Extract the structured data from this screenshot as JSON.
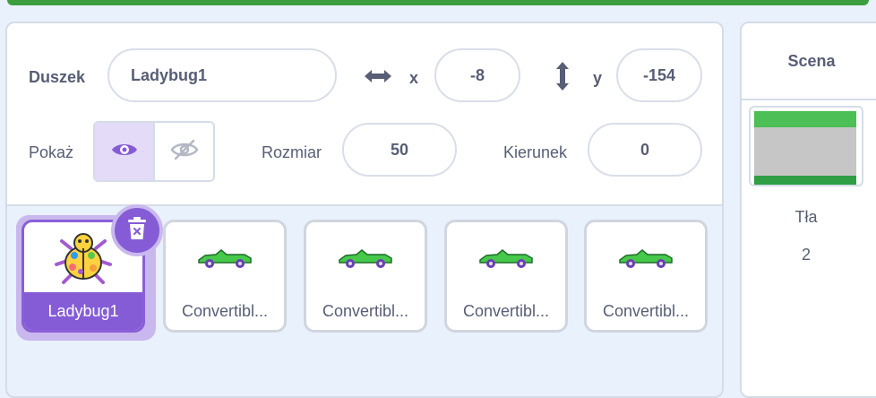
{
  "sprite_info": {
    "sprite_label": "Duszek",
    "sprite_name": "Ladybug1",
    "x_label": "x",
    "x_value": "-8",
    "y_label": "y",
    "y_value": "-154",
    "show_label": "Pokaż",
    "visible": true,
    "size_label": "Rozmiar",
    "size_value": "50",
    "direction_label": "Kierunek",
    "direction_value": "0"
  },
  "sprites": [
    {
      "name": "Ladybug1",
      "selected": true,
      "icon": "ladybug-icon"
    },
    {
      "name": "Convertibl...",
      "selected": false,
      "icon": "car-icon"
    },
    {
      "name": "Convertibl...",
      "selected": false,
      "icon": "car-icon"
    },
    {
      "name": "Convertibl...",
      "selected": false,
      "icon": "car-icon"
    },
    {
      "name": "Convertibl...",
      "selected": false,
      "icon": "car-icon"
    }
  ],
  "stage": {
    "title": "Scena",
    "backdrops_label": "Tła",
    "backdrops_count": "2"
  },
  "colors": {
    "accent": "#855cd6",
    "text": "#575e75",
    "pane_bg": "#e9f1fc",
    "top_bar": "#3c9e3c"
  }
}
